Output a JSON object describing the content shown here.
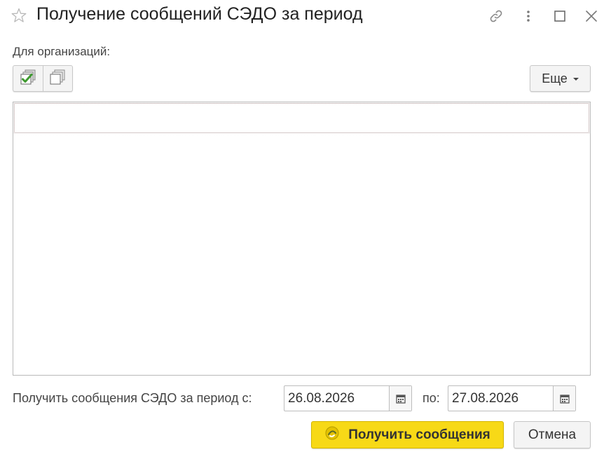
{
  "window": {
    "title": "Получение сообщений СЭДО за период",
    "icons": [
      "star-icon",
      "link-icon",
      "more-vertical-icon",
      "maximize-icon",
      "close-icon"
    ]
  },
  "organizations": {
    "label": "Для организаций:",
    "toolbar": {
      "buttons": [
        "check-all-icon",
        "uncheck-all-icon"
      ],
      "more_label": "Еще"
    },
    "rows": []
  },
  "period": {
    "label": "Получить сообщения СЭДО за период с:",
    "from_value": "26.08.2026",
    "to_label": "по:",
    "to_value": "27.08.2026"
  },
  "actions": {
    "get_messages_label": "Получить сообщения",
    "cancel_label": "Отмена"
  },
  "colors": {
    "primary_button": "#f7d917",
    "check_green": "#3e9a2f"
  }
}
